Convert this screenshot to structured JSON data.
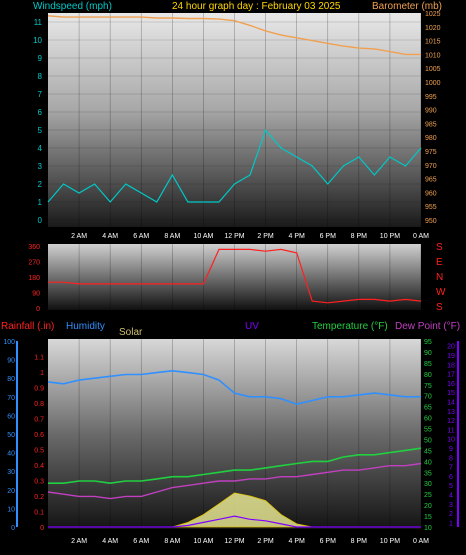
{
  "header": {
    "title": "24 hour graph day : February 03 2025",
    "left": "Windspeed (mph)",
    "right": "Barometer (mb)"
  },
  "labels": {
    "rainfall": "Rainfall (.in)",
    "humidity": "Humidity",
    "solar": "Solar",
    "uv": "UV",
    "temperature": "Temperature (°F)",
    "dewpoint": "Dew Point (°F)"
  },
  "time_ticks": [
    "2 AM",
    "4 AM",
    "6 AM",
    "8 AM",
    "10 AM",
    "12 PM",
    "2 PM",
    "4 PM",
    "6 PM",
    "8 PM",
    "10 PM",
    "0 AM"
  ],
  "compass": [
    "S",
    "E",
    "N",
    "W",
    "S"
  ],
  "colors": {
    "title": "#ffd700",
    "wind": "#00c8c8",
    "barometer": "#f0a050",
    "direction": "#ff2020",
    "humidity": "#3090ff",
    "temperature": "#20d040",
    "dewpoint": "#c040c0",
    "uv": "#8000ff",
    "solar": "#ffffa0",
    "rain": "#3090ff"
  },
  "chart_data": [
    {
      "type": "line",
      "name": "wind-barometer",
      "x_hours": [
        0,
        1,
        2,
        3,
        4,
        5,
        6,
        7,
        8,
        9,
        10,
        11,
        12,
        13,
        14,
        15,
        16,
        17,
        18,
        19,
        20,
        21,
        22,
        23,
        24
      ],
      "series": [
        {
          "name": "Windspeed",
          "axis": "left",
          "ylim": [
            0,
            11.5
          ],
          "values": [
            1,
            2,
            1.5,
            2,
            1,
            2,
            1.5,
            1,
            2.5,
            1,
            1,
            1,
            2,
            2.5,
            5,
            4,
            3.5,
            3,
            2,
            3,
            3.5,
            2.5,
            3.5,
            3,
            4
          ]
        },
        {
          "name": "Barometer",
          "axis": "right",
          "ylim": [
            950,
            1025
          ],
          "values": [
            1024,
            1023.5,
            1023.5,
            1023.5,
            1023.5,
            1023.5,
            1023.5,
            1023.2,
            1023.2,
            1023,
            1023,
            1022.8,
            1022.2,
            1020.5,
            1018.5,
            1017,
            1016,
            1015,
            1014,
            1013,
            1012.3,
            1012,
            1011,
            1010,
            1010
          ]
        }
      ],
      "left_ticks": [
        0,
        1,
        2,
        3,
        4,
        5,
        6,
        7,
        8,
        9,
        10,
        11
      ],
      "right_ticks": [
        950,
        955,
        960,
        965,
        970,
        975,
        980,
        985,
        990,
        995,
        1000,
        1005,
        1010,
        1015,
        1020,
        1025
      ]
    },
    {
      "type": "line",
      "name": "wind-direction",
      "x_hours": [
        0,
        1,
        2,
        3,
        4,
        5,
        6,
        7,
        8,
        9,
        10,
        11,
        12,
        13,
        14,
        15,
        16,
        17,
        18,
        19,
        20,
        21,
        22,
        23,
        24
      ],
      "series": [
        {
          "name": "Direction",
          "ylim": [
            0,
            360
          ],
          "values": [
            150,
            150,
            140,
            140,
            140,
            140,
            140,
            140,
            140,
            140,
            140,
            340,
            340,
            340,
            330,
            340,
            320,
            40,
            30,
            40,
            50,
            50,
            40,
            50,
            40
          ]
        }
      ],
      "y_ticks": [
        0,
        90,
        180,
        270,
        360
      ]
    },
    {
      "type": "line",
      "name": "temp-humidity",
      "x_hours": [
        0,
        1,
        2,
        3,
        4,
        5,
        6,
        7,
        8,
        9,
        10,
        11,
        12,
        13,
        14,
        15,
        16,
        17,
        18,
        19,
        20,
        21,
        22,
        23,
        24
      ],
      "series": [
        {
          "name": "Humidity",
          "axis": "humidity",
          "ylim": [
            0,
            100
          ],
          "values": [
            78,
            77,
            79,
            80,
            81,
            82,
            82,
            83,
            84,
            83,
            82,
            79,
            72,
            70,
            70,
            69,
            66,
            68,
            70,
            70,
            71,
            72,
            71,
            70,
            70
          ]
        },
        {
          "name": "Temperature",
          "axis": "temperature",
          "ylim": [
            10,
            95
          ],
          "values": [
            30,
            30,
            31,
            31,
            30,
            31,
            31,
            32,
            33,
            33,
            34,
            35,
            36,
            36,
            37,
            38,
            39,
            40,
            40,
            42,
            43,
            43,
            44,
            45,
            46
          ]
        },
        {
          "name": "Dew Point",
          "axis": "temperature",
          "ylim": [
            10,
            95
          ],
          "values": [
            26,
            25,
            24,
            24,
            23,
            24,
            24,
            26,
            28,
            29,
            30,
            31,
            31,
            32,
            32,
            33,
            33,
            34,
            35,
            36,
            36,
            37,
            38,
            38,
            39
          ]
        },
        {
          "name": "Solar",
          "axis": "solar",
          "ylim": [
            0,
            1.2
          ],
          "values": [
            0,
            0,
            0,
            0,
            0,
            0,
            0,
            0,
            0,
            0.03,
            0.08,
            0.15,
            0.22,
            0.2,
            0.17,
            0.08,
            0.02,
            0,
            0,
            0,
            0,
            0,
            0,
            0,
            0
          ]
        },
        {
          "name": "UV",
          "axis": "solar",
          "ylim": [
            0,
            1.2
          ],
          "values": [
            0,
            0,
            0,
            0,
            0,
            0,
            0,
            0,
            0,
            0.01,
            0.03,
            0.05,
            0.07,
            0.05,
            0.04,
            0.02,
            0,
            0,
            0,
            0,
            0,
            0,
            0,
            0,
            0
          ]
        }
      ],
      "rain_ticks": [
        0,
        0.1,
        0.2,
        0.3,
        0.4,
        0.5,
        0.6,
        0.7,
        0.8,
        0.9,
        1,
        1.1
      ],
      "humidity_ticks": [
        0,
        10,
        20,
        30,
        40,
        50,
        60,
        70,
        80,
        90,
        100
      ],
      "temp_ticks": [
        10,
        15,
        20,
        25,
        30,
        35,
        40,
        45,
        50,
        55,
        60,
        65,
        70,
        75,
        80,
        85,
        90,
        95
      ],
      "dew_ticks": [
        1,
        2,
        3,
        4,
        5,
        6,
        7,
        8,
        9,
        10,
        11,
        12,
        13,
        14,
        15,
        16,
        17,
        18,
        19,
        20
      ]
    }
  ]
}
